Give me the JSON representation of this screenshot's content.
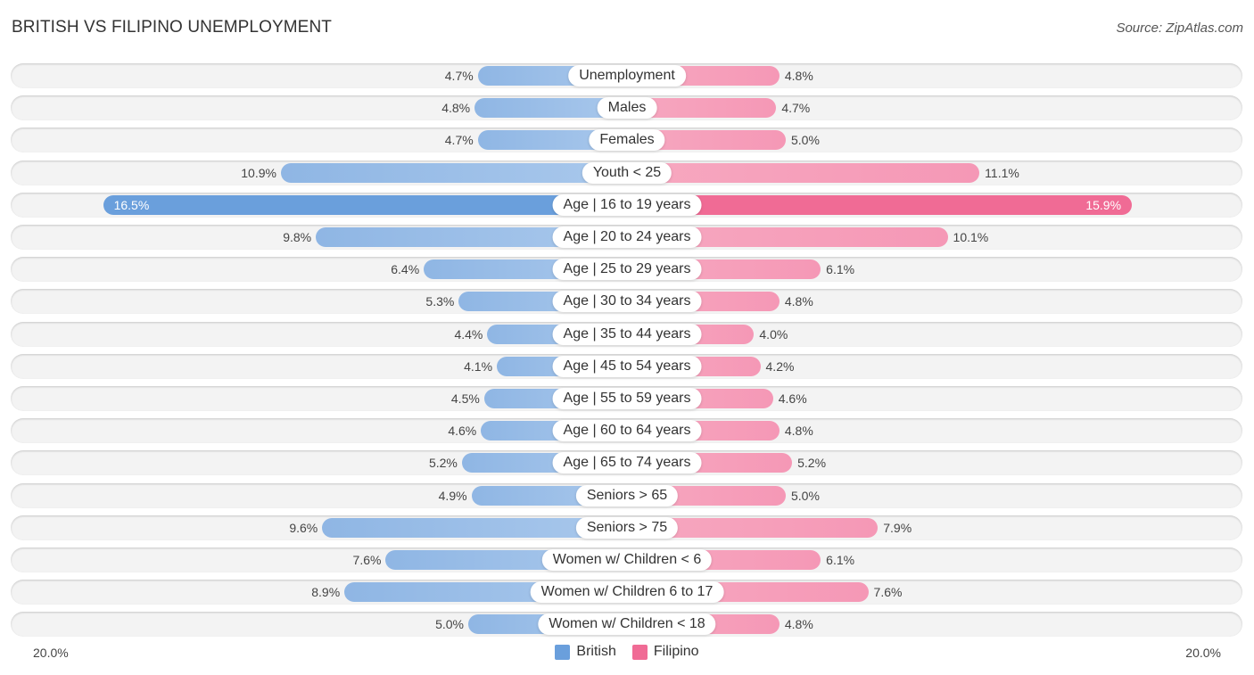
{
  "header": {
    "title": "BRITISH VS FILIPINO UNEMPLOYMENT",
    "source": "Source: ZipAtlas.com"
  },
  "chart_data": {
    "type": "bar",
    "orientation": "horizontal-diverging",
    "title": "BRITISH VS FILIPINO UNEMPLOYMENT",
    "xlabel": "",
    "ylabel": "",
    "xlim": [
      -20,
      20
    ],
    "axis_labels": {
      "left": "20.0%",
      "right": "20.0%"
    },
    "legend": {
      "placement": "bottom-center",
      "entries": [
        "British",
        "Filipino"
      ]
    },
    "colors": {
      "British": "#6a9fdc",
      "Filipino": "#f06b95",
      "British_light": "#a9c8ec",
      "Filipino_light": "#f7a8c0"
    },
    "categories": [
      "Unemployment",
      "Males",
      "Females",
      "Youth < 25",
      "Age | 16 to 19 years",
      "Age | 20 to 24 years",
      "Age | 25 to 29 years",
      "Age | 30 to 34 years",
      "Age | 35 to 44 years",
      "Age | 45 to 54 years",
      "Age | 55 to 59 years",
      "Age | 60 to 64 years",
      "Age | 65 to 74 years",
      "Seniors > 65",
      "Seniors > 75",
      "Women w/ Children < 6",
      "Women w/ Children 6 to 17",
      "Women w/ Children < 18"
    ],
    "series": [
      {
        "name": "British",
        "side": "left",
        "values": [
          4.7,
          4.8,
          4.7,
          10.9,
          16.5,
          9.8,
          6.4,
          5.3,
          4.4,
          4.1,
          4.5,
          4.6,
          5.2,
          4.9,
          9.6,
          7.6,
          8.9,
          5.0
        ],
        "labels": [
          "4.7%",
          "4.8%",
          "4.7%",
          "10.9%",
          "16.5%",
          "9.8%",
          "6.4%",
          "5.3%",
          "4.4%",
          "4.1%",
          "4.5%",
          "4.6%",
          "5.2%",
          "4.9%",
          "9.6%",
          "7.6%",
          "8.9%",
          "5.0%"
        ]
      },
      {
        "name": "Filipino",
        "side": "right",
        "values": [
          4.8,
          4.7,
          5.0,
          11.1,
          15.9,
          10.1,
          6.1,
          4.8,
          4.0,
          4.2,
          4.6,
          4.8,
          5.2,
          5.0,
          7.9,
          6.1,
          7.6,
          4.8
        ],
        "labels": [
          "4.8%",
          "4.7%",
          "5.0%",
          "11.1%",
          "15.9%",
          "10.1%",
          "6.1%",
          "4.8%",
          "4.0%",
          "4.2%",
          "4.6%",
          "4.8%",
          "5.2%",
          "5.0%",
          "7.9%",
          "6.1%",
          "7.6%",
          "4.8%"
        ]
      }
    ],
    "highlighted_category_index": 4
  }
}
